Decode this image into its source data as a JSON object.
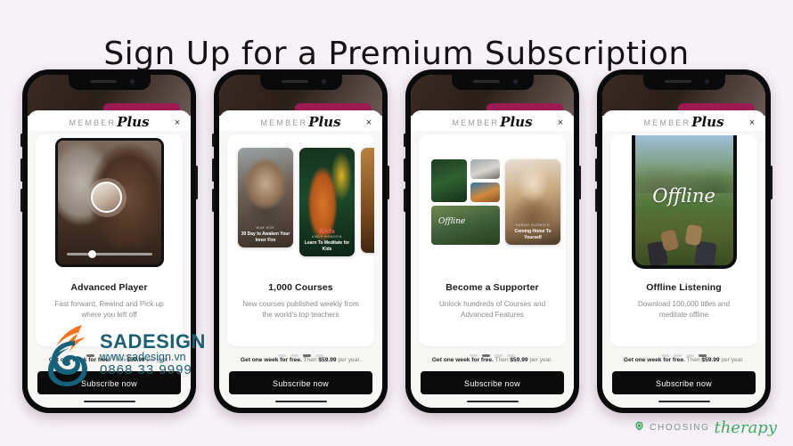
{
  "page": {
    "title": "Sign Up for a Premium Subscription",
    "background_color": "#f7f2f7"
  },
  "brand": {
    "member_label": "MEMBER",
    "plus_label": "Plus",
    "close_icon": "×"
  },
  "shared": {
    "price_prefix": "Get one week for free.",
    "price_suffix_a": " Then ",
    "price_amount": "$59.99",
    "price_suffix_b": " per year.",
    "subscribe_label": "Subscribe now"
  },
  "phones": [
    {
      "id": "phone-1",
      "card_title": "Advanced Player",
      "card_sub": "Fast forward, Rewind and Pick up where you left off",
      "active_dot": 0,
      "media_type": "video-player",
      "progress_percent": 30
    },
    {
      "id": "phone-2",
      "card_title": "1,000 Courses",
      "card_sub": "New courses published weekly from the world's top teachers",
      "active_dot": 2,
      "media_type": "course-carousel",
      "courses": [
        {
          "author": "WIM HOF",
          "title": "30 Day to Awaken Your Inner Fire"
        },
        {
          "kicker": "Kids",
          "author": "ANDY HOBSON",
          "title": "Learn To Meditate for Kids"
        },
        {
          "author": "",
          "title": ""
        }
      ]
    },
    {
      "id": "phone-3",
      "card_title": "Become a Supporter",
      "card_sub": "Unlock hundreds of Courses and Advanced Features",
      "active_dot": 1,
      "media_type": "course-grid",
      "grid_offline_word": "Offline",
      "featured": {
        "author": "SARAH BLONDIN",
        "title": "Coming Home To Yourself"
      }
    },
    {
      "id": "phone-4",
      "card_title": "Offline Listening",
      "card_sub": "Download 100,000 titles and meditate offline",
      "active_dot": 3,
      "media_type": "offline-phone",
      "offline_word": "Offline"
    }
  ],
  "watermark": {
    "name": "SADESIGN",
    "url": "www.sadesign.vn",
    "phone": "0868 33 9999",
    "color": "#1b5f73"
  },
  "footer_logo": {
    "icon": "leaf-icon",
    "word": "CHOOSING",
    "script": "therapy",
    "color": "#3fa862"
  }
}
